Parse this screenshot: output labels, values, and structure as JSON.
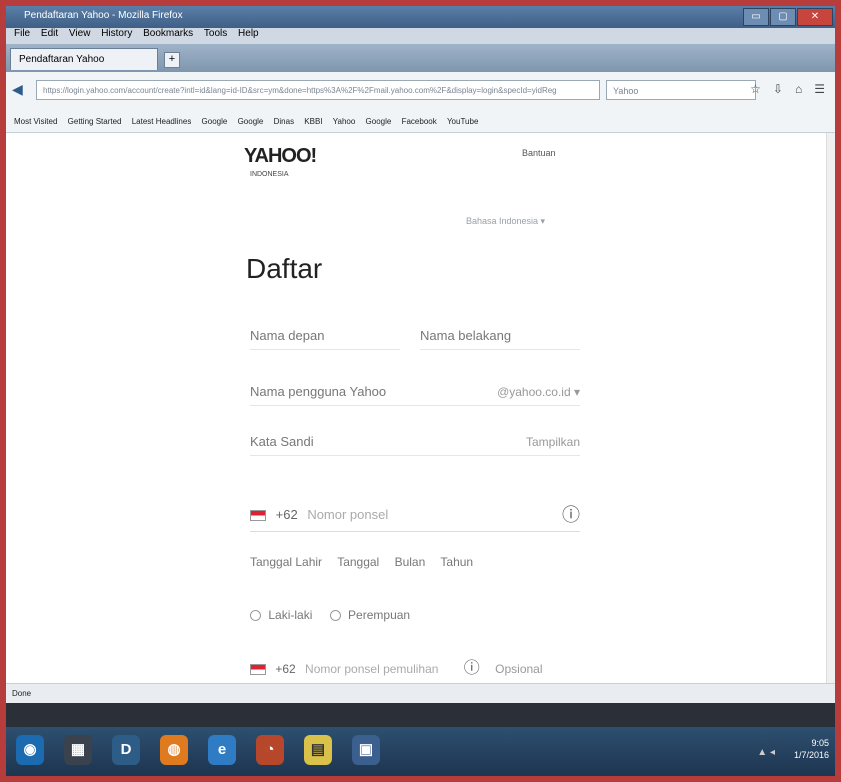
{
  "window": {
    "title": "Pendaftaran Yahoo - Mozilla Firefox",
    "buttons": {
      "minimize": "▭",
      "maximize": "▢",
      "close": "✕"
    }
  },
  "menubar": {
    "items": [
      "File",
      "Edit",
      "View",
      "History",
      "Bookmarks",
      "Tools",
      "Help"
    ]
  },
  "tab": {
    "label": "Pendaftaran Yahoo",
    "new_tab": "+"
  },
  "nav": {
    "back": "◀",
    "url": "https://login.yahoo.com/account/create?intl=id&lang=id-ID&src=ym&done=https%3A%2F%2Fmail.yahoo.com%2F&display=login&specId=yidReg",
    "search_placeholder": "Yahoo",
    "icons": [
      "☆",
      "⇩",
      "⌂",
      "☰"
    ]
  },
  "bookmarks": {
    "items": [
      "Most Visited",
      "Getting Started",
      "Latest Headlines",
      "Google",
      "Google",
      "Dinas",
      "KBBI",
      "Yahoo",
      "Google",
      "Facebook",
      "YouTube"
    ]
  },
  "page": {
    "logo": "YAHOO!",
    "logo_sub": "INDONESIA",
    "help": "Bantuan",
    "language": "Bahasa Indonesia ▾",
    "heading": "Daftar",
    "first_name": "Nama depan",
    "last_name": "Nama belakang",
    "username": "Nama pengguna Yahoo",
    "username_suffix": "@yahoo.co.id ▾",
    "password": "Kata Sandi",
    "password_suffix": "Tampilkan",
    "phone_code": "+62",
    "phone_placeholder": "Nomor ponsel",
    "phone_info": "ⓘ",
    "dob_label": "Tanggal Lahir",
    "dob_day": "Tanggal",
    "dob_month": "Bulan",
    "dob_year": "Tahun",
    "gender_male": "Laki-laki",
    "gender_female": "Perempuan",
    "alt_code": "+62",
    "alt_phone": "Nomor ponsel pemulihan",
    "alt_info": "ⓘ",
    "alt_optional": "Opsional"
  },
  "statusbar": {
    "text": "Done"
  },
  "taskbar": {
    "icons": [
      "◉",
      "▦",
      "D",
      "◍",
      "e",
      "◔",
      "▤",
      "▣"
    ],
    "tray": "▲ ◂",
    "time": "9:05",
    "date": "1/7/2016"
  },
  "colors": {
    "border": "#b73c3c",
    "accent": "#3f5f86"
  }
}
